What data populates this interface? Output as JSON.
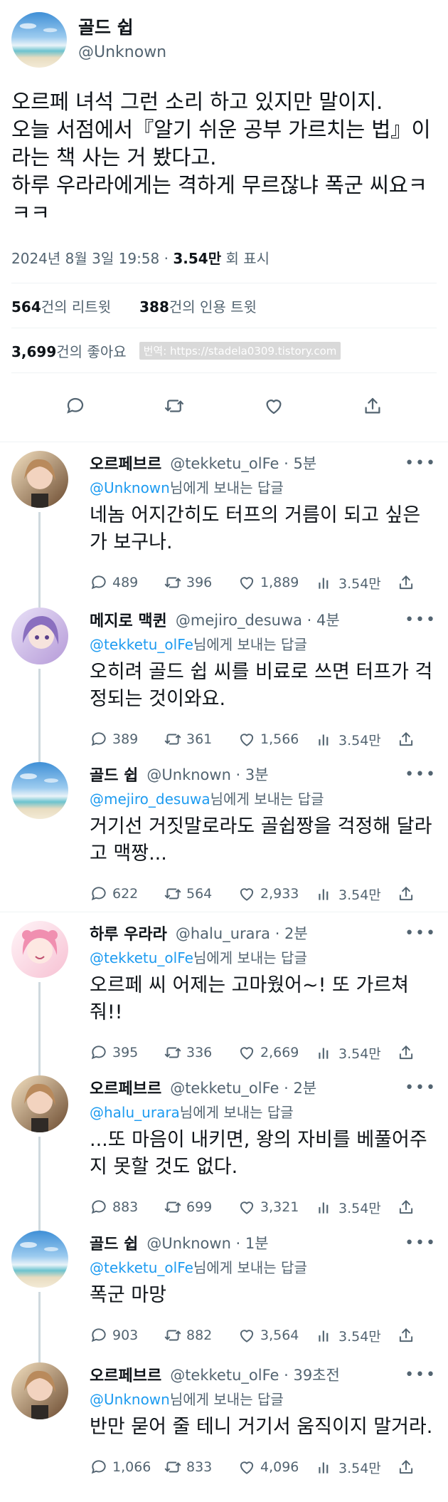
{
  "colors": {
    "link": "#1d9bf0",
    "secondary": "#536471",
    "text": "#0f1419",
    "border": "#eff3f4"
  },
  "main_tweet": {
    "name": "골드 쉽",
    "handle": "@Unknown",
    "text": "오르페 녀석 그런 소리 하고 있지만 말이지.\n오늘 서점에서『알기 쉬운 공부 가르치는 법』이라는 책 사는 거 봤다고.\n하루 우라라에게는 격하게 무르잖냐 폭군 씨요ㅋㅋㅋ",
    "date": "2024년 8월 3일  19:58 · ",
    "views": "3.54만",
    "views_label": " 회 표시",
    "retweets": "564",
    "retweets_label": "건의 리트윗",
    "quotes": "388",
    "quotes_label": "건의 인용 트윗",
    "likes": "3,699",
    "likes_label": "건의 좋아요",
    "watermark": "번역: https://stadela0309.tistory.com",
    "icons": [
      "reply-icon",
      "retweet-icon",
      "like-icon",
      "share-icon"
    ]
  },
  "replies": [
    {
      "name": "오르페브르",
      "handle": "@tekketu_olFe",
      "time": " · 5분",
      "reply_to": "@Unknown",
      "reply_suffix": "님에게 보내는 답글",
      "text": "네놈 어지간히도 터프의 거름이 되고 싶은가 보구나.",
      "stats": {
        "replies": "489",
        "retweets": "396",
        "likes": "1,889",
        "views": "3.54만"
      }
    },
    {
      "name": "메지로 맥퀸",
      "handle": "@mejiro_desuwa",
      "time": " · 4분",
      "reply_to": "@tekketu_olFe",
      "reply_suffix": "님에게 보내는 답글",
      "text": "오히려 골드 쉽 씨를 비료로 쓰면 터프가 걱정되는 것이와요.",
      "stats": {
        "replies": "389",
        "retweets": "361",
        "likes": "1,566",
        "views": "3.54만"
      }
    },
    {
      "name": "골드 쉽",
      "handle": "@Unknown",
      "time": " · 3분",
      "reply_to": "@mejiro_desuwa",
      "reply_suffix": "님에게 보내는 답글",
      "text": "거기선 거짓말로라도 골쉽짱을 걱정해 달라고 맥짱...",
      "stats": {
        "replies": "622",
        "retweets": "564",
        "likes": "2,933",
        "views": "3.54만"
      }
    },
    {
      "name": "하루 우라라",
      "handle": "@halu_urara",
      "time": " · 2분",
      "reply_to": "@tekketu_olFe",
      "reply_suffix": "님에게 보내는 답글",
      "text": "오르페 씨 어제는 고마웠어~! 또 가르쳐 줘!!",
      "stats": {
        "replies": "395",
        "retweets": "336",
        "likes": "2,669",
        "views": "3.54만"
      }
    },
    {
      "name": "오르페브르",
      "handle": "@tekketu_olFe",
      "time": " · 2분",
      "reply_to": "@halu_urara",
      "reply_suffix": "님에게 보내는 답글",
      "text": "...또 마음이 내키면, 왕의 자비를 베풀어주지 못할 것도 없다.",
      "stats": {
        "replies": "883",
        "retweets": "699",
        "likes": "3,321",
        "views": "3.54만"
      }
    },
    {
      "name": "골드 쉽",
      "handle": "@Unknown",
      "time": " · 1분",
      "reply_to": "@tekketu_olFe",
      "reply_suffix": "님에게 보내는 답글",
      "text": "폭군 마망",
      "stats": {
        "replies": "903",
        "retweets": "882",
        "likes": "3,564",
        "views": "3.54만"
      }
    },
    {
      "name": "오르페브르",
      "handle": "@tekketu_olFe",
      "time": " · 39초전",
      "reply_to": "@Unknown",
      "reply_suffix": "님에게 보내는 답글",
      "text": "반만 묻어 줄 테니 거기서 움직이지 말거라.",
      "stats": {
        "replies": "1,066",
        "retweets": "833",
        "likes": "4,096",
        "views": "3.54만"
      }
    }
  ]
}
